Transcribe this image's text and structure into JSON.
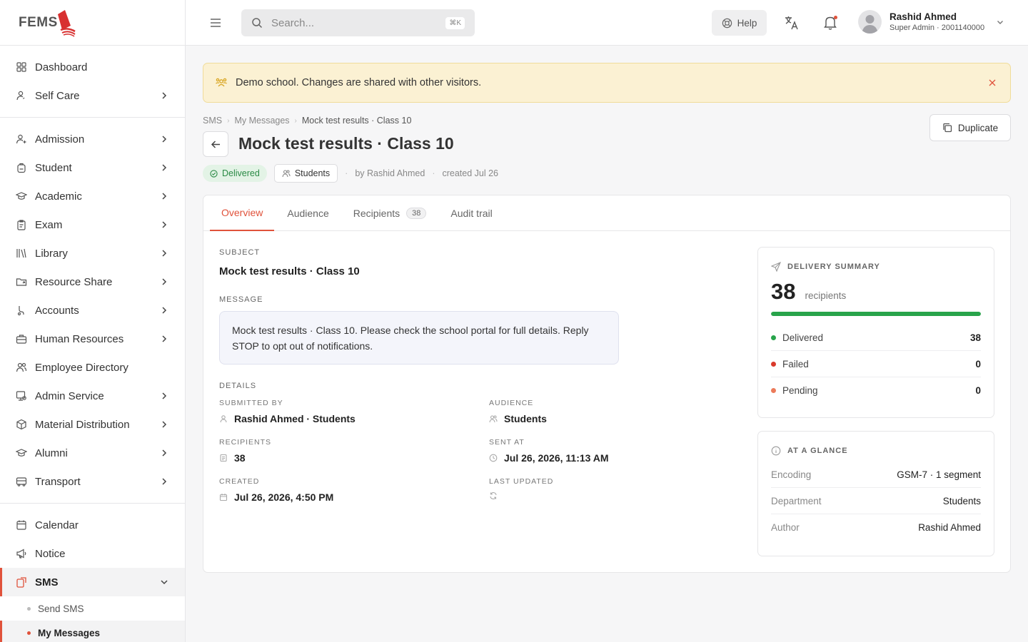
{
  "brand": {
    "logo_text": "FEMS",
    "accent": "#e0523b"
  },
  "sidebar": {
    "group1": [
      {
        "label": "Dashboard",
        "icon": "grid-icon",
        "chevron": false
      },
      {
        "label": "Self Care",
        "icon": "user-heart-icon",
        "chevron": true
      }
    ],
    "group2": [
      {
        "label": "Admission",
        "icon": "user-plus-icon",
        "chevron": true
      },
      {
        "label": "Student",
        "icon": "backpack-icon",
        "chevron": true
      },
      {
        "label": "Academic",
        "icon": "graduation-cap-icon",
        "chevron": true
      },
      {
        "label": "Exam",
        "icon": "clipboard-icon",
        "chevron": true
      },
      {
        "label": "Library",
        "icon": "library-icon",
        "chevron": true
      },
      {
        "label": "Resource Share",
        "icon": "folder-share-icon",
        "chevron": true
      },
      {
        "label": "Accounts",
        "icon": "accounts-icon",
        "chevron": true
      },
      {
        "label": "Human Resources",
        "icon": "briefcase-icon",
        "chevron": true
      },
      {
        "label": "Employee Directory",
        "icon": "users-icon",
        "chevron": false
      },
      {
        "label": "Admin Service",
        "icon": "admin-service-icon",
        "chevron": true
      },
      {
        "label": "Material Distribution",
        "icon": "box-icon",
        "chevron": true
      },
      {
        "label": "Alumni",
        "icon": "graduation-cap-icon",
        "chevron": true
      },
      {
        "label": "Transport",
        "icon": "bus-icon",
        "chevron": true
      }
    ],
    "group3": [
      {
        "label": "Calendar",
        "icon": "calendar-icon",
        "chevron": false
      },
      {
        "label": "Notice",
        "icon": "megaphone-icon",
        "chevron": false
      }
    ],
    "sms": {
      "label": "SMS",
      "sub": [
        {
          "label": "Send SMS"
        },
        {
          "label": "My Messages"
        }
      ]
    }
  },
  "topbar": {
    "search_placeholder": "Search...",
    "shortcut": "⌘K",
    "help_label": "Help",
    "user_name": "Rashid Ahmed",
    "user_role": "Super Admin · 2001140000"
  },
  "banner": {
    "text": "Demo school. Changes are shared with other visitors."
  },
  "breadcrumb": [
    "SMS",
    "My Messages",
    "Mock test results · Class 10"
  ],
  "page": {
    "title": "Mock test results · Class 10",
    "duplicate_label": "Duplicate",
    "status": "Delivered",
    "audience_badge": "Students",
    "by": "by Rashid Ahmed",
    "created": "created Jul 26"
  },
  "tabs": [
    {
      "label": "Overview",
      "active": true
    },
    {
      "label": "Audience"
    },
    {
      "label": "Recipients",
      "count": "38"
    },
    {
      "label": "Audit trail"
    }
  ],
  "overview": {
    "subject_label": "SUBJECT",
    "subject": "Mock test results · Class 10",
    "message_label": "MESSAGE",
    "message": "Mock test results · Class 10. Please check the school portal for full details. Reply STOP to opt out of notifications.",
    "details_label": "DETAILS",
    "details": {
      "submitted_by_label": "SUBMITTED BY",
      "submitted_by": "Rashid Ahmed · Students",
      "audience_label": "AUDIENCE",
      "audience": "Students",
      "recipients_label": "RECIPIENTS",
      "recipients": "38",
      "sent_at_label": "SENT AT",
      "sent_at": "Jul 26, 2026, 11:13 AM",
      "created_label": "CREATED",
      "created": "Jul 26, 2026, 4:50 PM",
      "last_updated_label": "LAST UPDATED"
    }
  },
  "delivery_summary": {
    "label": "DELIVERY SUMMARY",
    "total": "38",
    "unit": "recipients",
    "progress_fraction": 1.0,
    "rows": [
      {
        "label": "Delivered",
        "value": "38",
        "color": "#28a44b"
      },
      {
        "label": "Failed",
        "value": "0",
        "color": "#d93a2b"
      },
      {
        "label": "Pending",
        "value": "0",
        "color": "#ec7b5a"
      }
    ]
  },
  "glance": {
    "label": "AT A GLANCE",
    "rows": [
      {
        "key": "Encoding",
        "value": "GSM-7 · 1 segment"
      },
      {
        "key": "Department",
        "value": "Students"
      },
      {
        "key": "Author",
        "value": "Rashid Ahmed"
      }
    ]
  }
}
